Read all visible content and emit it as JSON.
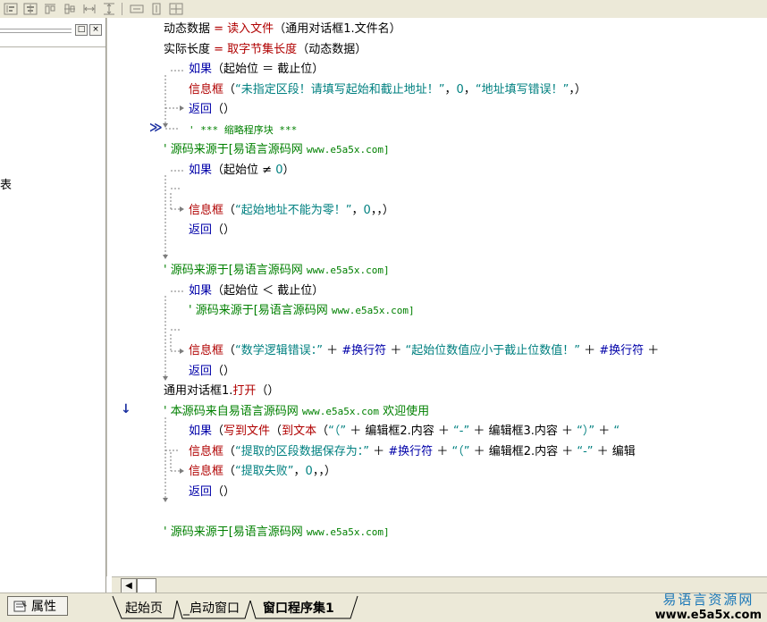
{
  "left_panel": {
    "fragment": "表",
    "pin_label": "□",
    "close_label": "×",
    "properties_label": "属性"
  },
  "code": {
    "lines": [
      {
        "id": "l1",
        "parts": [
          {
            "t": "动态数据 ",
            "c": "black"
          },
          {
            "t": "= ",
            "c": "red"
          },
          {
            "t": "读入文件",
            "c": "red"
          },
          {
            "t": "（通用对话框1.文件名）",
            "c": "black"
          }
        ]
      },
      {
        "id": "l2",
        "parts": [
          {
            "t": "实际长度 ",
            "c": "black"
          },
          {
            "t": "= ",
            "c": "red"
          },
          {
            "t": "取字节集长度",
            "c": "red"
          },
          {
            "t": "（动态数据）",
            "c": "black"
          }
        ]
      },
      {
        "id": "l3",
        "parts": [
          {
            "t": "如果",
            "c": "blue"
          },
          {
            "t": "（起始位 ＝ 截止位）",
            "c": "black"
          }
        ]
      },
      {
        "id": "l4",
        "parts": [
          {
            "t": "信息框",
            "c": "red"
          },
          {
            "t": "（",
            "c": "black"
          },
          {
            "t": "“未指定区段！请填写起始和截止地址！”",
            "c": "str"
          },
          {
            "t": "，",
            "c": "black"
          },
          {
            "t": "0",
            "c": "str"
          },
          {
            "t": "，",
            "c": "black"
          },
          {
            "t": "“地址填写错误！”",
            "c": "str"
          },
          {
            "t": "，）",
            "c": "black"
          }
        ]
      },
      {
        "id": "l5",
        "parts": [
          {
            "t": "返回",
            "c": "blue"
          },
          {
            "t": "（）",
            "c": "black"
          }
        ]
      },
      {
        "id": "l6",
        "parts": [
          {
            "t": "' *** 缩略程序块 ***",
            "c": "green",
            "mono": true
          }
        ]
      },
      {
        "id": "l7",
        "parts": [
          {
            "t": "' 源码来源于[易语言源码网 ",
            "c": "green"
          },
          {
            "t": "www.e5a5x.com]",
            "c": "green",
            "mono": true
          }
        ]
      },
      {
        "id": "l8",
        "parts": [
          {
            "t": "如果",
            "c": "blue"
          },
          {
            "t": "（起始位 ≠ ",
            "c": "black"
          },
          {
            "t": "0",
            "c": "str"
          },
          {
            "t": "）",
            "c": "black"
          }
        ]
      },
      {
        "id": "l9",
        "parts": [
          {
            "t": "信息框",
            "c": "red"
          },
          {
            "t": "（",
            "c": "black"
          },
          {
            "t": "“起始地址不能为零！”",
            "c": "str"
          },
          {
            "t": "，",
            "c": "black"
          },
          {
            "t": "0",
            "c": "str"
          },
          {
            "t": "，，）",
            "c": "black"
          }
        ]
      },
      {
        "id": "l10",
        "parts": [
          {
            "t": "返回",
            "c": "blue"
          },
          {
            "t": "（）",
            "c": "black"
          }
        ]
      },
      {
        "id": "l11",
        "parts": [
          {
            "t": "' 源码来源于[易语言源码网 ",
            "c": "green"
          },
          {
            "t": "www.e5a5x.com]",
            "c": "green",
            "mono": true
          }
        ]
      },
      {
        "id": "l12",
        "parts": [
          {
            "t": "如果",
            "c": "blue"
          },
          {
            "t": "（起始位 ＜ 截止位）",
            "c": "black"
          }
        ]
      },
      {
        "id": "l13",
        "parts": [
          {
            "t": "' 源码来源于[易语言源码网 ",
            "c": "green"
          },
          {
            "t": "www.e5a5x.com]",
            "c": "green",
            "mono": true
          }
        ]
      },
      {
        "id": "l14",
        "parts": [
          {
            "t": "信息框",
            "c": "red"
          },
          {
            "t": "（",
            "c": "black"
          },
          {
            "t": "“数学逻辑错误：”",
            "c": "str"
          },
          {
            "t": " ＋ ",
            "c": "black"
          },
          {
            "t": "#换行符",
            "c": "blue"
          },
          {
            "t": " ＋ ",
            "c": "black"
          },
          {
            "t": "“起始位数值应小于截止位数值！”",
            "c": "str"
          },
          {
            "t": " ＋ ",
            "c": "black"
          },
          {
            "t": "#换行符",
            "c": "blue"
          },
          {
            "t": " ＋",
            "c": "black"
          }
        ]
      },
      {
        "id": "l15",
        "parts": [
          {
            "t": "返回",
            "c": "blue"
          },
          {
            "t": "（）",
            "c": "black"
          }
        ]
      },
      {
        "id": "l16",
        "parts": [
          {
            "t": "通用对话框1.",
            "c": "black"
          },
          {
            "t": "打开",
            "c": "red"
          },
          {
            "t": "（）",
            "c": "black"
          }
        ]
      },
      {
        "id": "l17",
        "parts": [
          {
            "t": "' 本源码来自易语言源码网 ",
            "c": "green"
          },
          {
            "t": "www.e5a5x.com",
            "c": "green",
            "mono": true
          },
          {
            "t": "  欢迎使用",
            "c": "green"
          }
        ]
      },
      {
        "id": "l18",
        "parts": [
          {
            "t": "如果",
            "c": "blue"
          },
          {
            "t": "（",
            "c": "black"
          },
          {
            "t": "写到文件",
            "c": "red"
          },
          {
            "t": "（",
            "c": "black"
          },
          {
            "t": "到文本",
            "c": "red"
          },
          {
            "t": "（",
            "c": "black"
          },
          {
            "t": "“（”",
            "c": "str"
          },
          {
            "t": " ＋ 编辑框2.内容 ＋ ",
            "c": "black"
          },
          {
            "t": "“-”",
            "c": "str"
          },
          {
            "t": " ＋ 编辑框3.内容 ＋ ",
            "c": "black"
          },
          {
            "t": "“）”",
            "c": "str"
          },
          {
            "t": " ＋ ",
            "c": "black"
          },
          {
            "t": "“",
            "c": "str"
          }
        ]
      },
      {
        "id": "l19",
        "parts": [
          {
            "t": "信息框",
            "c": "red"
          },
          {
            "t": "（",
            "c": "black"
          },
          {
            "t": "“提取的区段数据保存为：”",
            "c": "str"
          },
          {
            "t": " ＋ ",
            "c": "black"
          },
          {
            "t": "#换行符",
            "c": "blue"
          },
          {
            "t": " ＋ ",
            "c": "black"
          },
          {
            "t": "“（”",
            "c": "str"
          },
          {
            "t": " ＋ 编辑框2.内容 ＋ ",
            "c": "black"
          },
          {
            "t": "“-”",
            "c": "str"
          },
          {
            "t": " ＋ 编辑",
            "c": "black"
          }
        ]
      },
      {
        "id": "l20",
        "parts": [
          {
            "t": "信息框",
            "c": "red"
          },
          {
            "t": "（",
            "c": "black"
          },
          {
            "t": "“提取失败”",
            "c": "str"
          },
          {
            "t": "，",
            "c": "black"
          },
          {
            "t": "0",
            "c": "str"
          },
          {
            "t": "，，）",
            "c": "black"
          }
        ]
      },
      {
        "id": "l21",
        "parts": [
          {
            "t": "返回",
            "c": "blue"
          },
          {
            "t": "（）",
            "c": "black"
          }
        ]
      },
      {
        "id": "l22",
        "parts": [
          {
            "t": "' 源码来源于[易语言源码网 ",
            "c": "green"
          },
          {
            "t": "www.e5a5x.com]",
            "c": "green",
            "mono": true
          }
        ]
      }
    ]
  },
  "markers": {
    "collapsed": "≫",
    "current": "↓"
  },
  "tabs": [
    {
      "label": "起始页",
      "active": false
    },
    {
      "label": "_启动窗口",
      "active": false
    },
    {
      "label": "窗口程序集1",
      "active": true
    }
  ],
  "brand": {
    "line1": "易语言资源网",
    "line2": "www.e5a5x.com"
  },
  "colors": {
    "keyword": "#0000a8",
    "function": "#b00000",
    "string": "#008080",
    "comment": "#008000",
    "brand": "#1c78b8"
  }
}
